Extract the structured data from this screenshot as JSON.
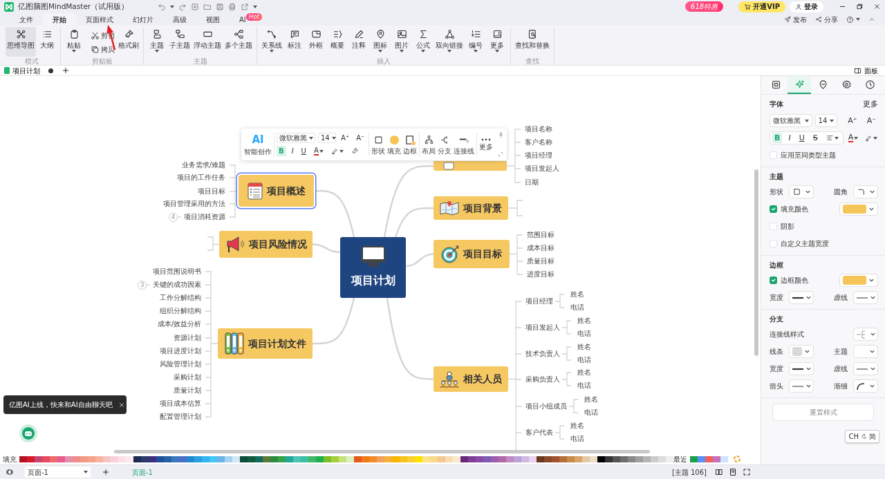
{
  "app": {
    "title": "亿图脑图MindMaster（试用版）"
  },
  "promo": {
    "label": "618特惠"
  },
  "vip_button": {
    "label": "开通VIP"
  },
  "login_button": {
    "label": "登录"
  },
  "menu_tabs": [
    {
      "label": "文件",
      "selected": false
    },
    {
      "label": "开始",
      "selected": true
    },
    {
      "label": "页面样式",
      "selected": false
    },
    {
      "label": "幻灯片",
      "selected": false
    },
    {
      "label": "高级",
      "selected": false
    },
    {
      "label": "视图",
      "selected": false
    },
    {
      "label": "AI",
      "selected": false,
      "badge": "Hot"
    }
  ],
  "header_actions": [
    {
      "label": "发布"
    },
    {
      "label": "分享"
    }
  ],
  "ribbon_groups": [
    {
      "label": "模式",
      "items": [
        {
          "label": "思维导图",
          "kind": "large",
          "dropdown": false,
          "selected": true
        },
        {
          "label": "大纲",
          "kind": "large",
          "dropdown": false,
          "selected": false
        }
      ]
    },
    {
      "label": "剪贴板",
      "items": [
        {
          "label": "粘贴",
          "kind": "large",
          "dropdown": true
        },
        {
          "label": "剪切",
          "kind": "small",
          "dropdown": false
        },
        {
          "label": "拷贝",
          "kind": "small",
          "dropdown": false
        },
        {
          "label": "格式刷",
          "kind": "large",
          "dropdown": false
        }
      ]
    },
    {
      "label": "主题",
      "items": [
        {
          "label": "主题",
          "kind": "large",
          "dropdown": true
        },
        {
          "label": "子主题",
          "kind": "large",
          "dropdown": false
        },
        {
          "label": "浮动主题",
          "kind": "large",
          "dropdown": false
        },
        {
          "label": "多个主题",
          "kind": "large",
          "dropdown": false
        }
      ]
    },
    {
      "label": "插入",
      "items": [
        {
          "label": "关系线",
          "kind": "large",
          "dropdown": true
        },
        {
          "label": "标注",
          "kind": "large",
          "dropdown": false
        },
        {
          "label": "外框",
          "kind": "large",
          "dropdown": false
        },
        {
          "label": "概要",
          "kind": "large",
          "dropdown": false
        },
        {
          "label": "注释",
          "kind": "large",
          "dropdown": false
        },
        {
          "label": "图标",
          "kind": "large",
          "dropdown": true
        },
        {
          "label": "图片",
          "kind": "large",
          "dropdown": true
        },
        {
          "label": "公式",
          "kind": "large",
          "dropdown": true
        },
        {
          "label": "双向链接",
          "kind": "large",
          "dropdown": true
        },
        {
          "label": "编号",
          "kind": "large",
          "dropdown": true
        },
        {
          "label": "更多",
          "kind": "large",
          "dropdown": true
        }
      ]
    },
    {
      "label": "查找",
      "items": [
        {
          "label": "查找和替换",
          "kind": "large",
          "dropdown": false
        }
      ]
    }
  ],
  "doc_tabs": [
    {
      "label": "项目计划",
      "selected": true,
      "unsaved": true
    }
  ],
  "panel_toggle": {
    "label": "面板"
  },
  "format_toolbar": {
    "ai": "AI",
    "ai_label": "智能创作",
    "font": "微软雅黑",
    "size": "14",
    "grow": "A⁺",
    "shrink": "A⁻",
    "styles": [
      {
        "label": "B",
        "selected": true
      },
      {
        "label": "I",
        "selected": false
      },
      {
        "label": "U",
        "selected": false
      }
    ],
    "color_label": "A",
    "color": "#e02020",
    "tools": [
      "形状",
      "填充",
      "边框",
      "布局",
      "分支",
      "连接线",
      "更多"
    ]
  },
  "mindmap": {
    "central": "项目计划",
    "topics": [
      {
        "label": "项目概述",
        "selected": true,
        "children": [
          {
            "label": "业务需求/难题"
          },
          {
            "label": "项目的工作任务"
          },
          {
            "label": "项目目标"
          },
          {
            "label": "项目管理采用的方法"
          },
          {
            "label": "项目消耗资源",
            "collapsed_count": "4"
          }
        ]
      },
      {
        "label": "项目风险情况",
        "selected": false
      },
      {
        "label": "项目计划文件",
        "selected": false,
        "children": [
          {
            "label": "项目范围说明书"
          },
          {
            "label": "关键的成功因素",
            "collapsed_count": "3"
          },
          {
            "label": "工作分解结构"
          },
          {
            "label": "组织分解结构"
          },
          {
            "label": "成本/效益分析"
          },
          {
            "label": "资源计划"
          },
          {
            "label": "项目进度计划"
          },
          {
            "label": "风险管理计划"
          },
          {
            "label": "采购计划"
          },
          {
            "label": "质量计划"
          },
          {
            "label": "项目成本估算"
          },
          {
            "label": "配置管理计划"
          }
        ]
      },
      {
        "selected": false,
        "children": [
          {
            "label": "项目名称"
          },
          {
            "label": "客户名称"
          },
          {
            "label": "项目经理"
          },
          {
            "label": "项目发起人"
          },
          {
            "label": "日期"
          }
        ]
      },
      {
        "label": "项目背景",
        "selected": false
      },
      {
        "label": "项目目标",
        "selected": false,
        "children": [
          {
            "label": "范围目标"
          },
          {
            "label": "成本目标"
          },
          {
            "label": "质量目标"
          },
          {
            "label": "进度目标"
          }
        ]
      },
      {
        "label": "相关人员",
        "selected": false,
        "children": [
          {
            "label": "项目经理",
            "children": [
              {
                "label": "姓名"
              },
              {
                "label": "电话"
              }
            ]
          },
          {
            "label": "项目发起人",
            "children": [
              {
                "label": "姓名"
              },
              {
                "label": "电话"
              }
            ]
          },
          {
            "label": "技术负责人",
            "children": [
              {
                "label": "姓名"
              },
              {
                "label": "电话"
              }
            ]
          },
          {
            "label": "采购负责人",
            "children": [
              {
                "label": "姓名"
              },
              {
                "label": "电话"
              }
            ]
          },
          {
            "label": "项目小组成员",
            "children": [
              {
                "label": "姓名"
              },
              {
                "label": "电话"
              }
            ]
          },
          {
            "label": "客户代表",
            "children": [
              {
                "label": "姓名"
              },
              {
                "label": "电话"
              }
            ]
          }
        ]
      }
    ]
  },
  "ai_tip": {
    "text": "亿图AI上线，快来和AI自由聊天吧"
  },
  "panel": {
    "tabs": [
      {
        "selected": false
      },
      {
        "selected": true
      },
      {
        "selected": false
      },
      {
        "selected": false
      },
      {
        "selected": false
      }
    ],
    "sections": [
      {
        "title": "字体",
        "more": "更多",
        "rows": [
          {
            "kind": "font",
            "font": "微软雅黑",
            "size": "14",
            "grow": "A⁺",
            "shrink": "A⁻"
          },
          {
            "kind": "format",
            "styles": [
              {
                "label": "B",
                "selected": true
              },
              {
                "label": "I",
                "selected": false
              },
              {
                "label": "U",
                "selected": false
              },
              {
                "label": "S",
                "selected": false
              }
            ],
            "color_label": "A",
            "color": "#e02020"
          },
          {
            "kind": "check",
            "label": "应用至同类型主题",
            "checked": false
          }
        ]
      },
      {
        "title": "主题",
        "rows": [
          {
            "kind": "pair",
            "items": [
              {
                "label": "形状",
                "kind": "shape"
              },
              {
                "label": "圆角",
                "kind": "corner"
              }
            ]
          },
          {
            "kind": "check",
            "label": "填充颜色",
            "checked": true,
            "color": "#f5c55a"
          },
          {
            "kind": "check",
            "label": "阴影",
            "checked": false
          },
          {
            "kind": "check",
            "label": "自定义主题宽度",
            "checked": false
          }
        ]
      },
      {
        "title": "边框",
        "rows": [
          {
            "kind": "check",
            "label": "边框颜色",
            "checked": true,
            "color": "#f5c55a"
          },
          {
            "kind": "pair",
            "items": [
              {
                "label": "宽度",
                "kind": "thick"
              },
              {
                "label": "虚线",
                "kind": "thin"
              }
            ]
          }
        ]
      },
      {
        "title": "分支",
        "rows": [
          {
            "kind": "single",
            "items": [
              {
                "label": "连接线样式",
                "kind": "connector"
              }
            ]
          },
          {
            "kind": "pair",
            "items": [
              {
                "label": "线条",
                "kind": "swatch",
                "color": "#d9d9d9"
              },
              {
                "label": "主题",
                "kind": "empty"
              }
            ]
          },
          {
            "kind": "pair",
            "items": [
              {
                "label": "宽度",
                "kind": "thick"
              },
              {
                "label": "虚线",
                "kind": "thin"
              }
            ]
          },
          {
            "kind": "pair",
            "items": [
              {
                "label": "箭头",
                "kind": "thin"
              },
              {
                "label": "渐细",
                "kind": "taper"
              }
            ]
          }
        ]
      }
    ],
    "reset": {
      "label": "重置样式",
      "disabled": true
    }
  },
  "ime": {
    "lang": "CH",
    "mode": "简"
  },
  "palette": {
    "label": "填充",
    "recent_label": "最近",
    "swatches": [
      {
        "color": "#b3121f"
      },
      {
        "color": "#d71a2a"
      },
      {
        "color": "#c5476f"
      },
      {
        "color": "#e84a5f"
      },
      {
        "color": "#ef6b6b"
      },
      {
        "color": "#e65c8e"
      },
      {
        "color": "#e58fb0"
      },
      {
        "color": "#f08b8b"
      },
      {
        "color": "#f29b84"
      },
      {
        "color": "#f6a38a"
      },
      {
        "color": "#f9b4a0"
      },
      {
        "color": "#f7c4c4"
      },
      {
        "color": "#f8d0dc"
      },
      {
        "color": "#fce0e8"
      },
      {
        "color": "#fde9ee"
      },
      {
        "color": "#1b2a4e"
      },
      {
        "color": "#2a3a6e"
      },
      {
        "color": "#3c2f80"
      },
      {
        "color": "#1f4f9a"
      },
      {
        "color": "#2462a8"
      },
      {
        "color": "#3a7bbf"
      },
      {
        "color": "#4a6fc5"
      },
      {
        "color": "#1f8ad2"
      },
      {
        "color": "#2aa0e0"
      },
      {
        "color": "#33b5f0"
      },
      {
        "color": "#45c6f5"
      },
      {
        "color": "#6fb3e6"
      },
      {
        "color": "#a7d2f0"
      },
      {
        "color": "#d0e8f7"
      },
      {
        "color": "#0d4d3a"
      },
      {
        "color": "#0f5c3b"
      },
      {
        "color": "#116b5a"
      },
      {
        "color": "#5a7a3a"
      },
      {
        "color": "#2e8b3e"
      },
      {
        "color": "#35a34a"
      },
      {
        "color": "#20a89a"
      },
      {
        "color": "#4fc1b5"
      },
      {
        "color": "#3bbfa0"
      },
      {
        "color": "#44b86a"
      },
      {
        "color": "#1fb14d"
      },
      {
        "color": "#7cbf2a"
      },
      {
        "color": "#a6cf3c"
      },
      {
        "color": "#c6e27a"
      },
      {
        "color": "#dcefc0"
      },
      {
        "color": "#e55a1c"
      },
      {
        "color": "#ef7a1a"
      },
      {
        "color": "#f28c28"
      },
      {
        "color": "#f5a05a"
      },
      {
        "color": "#f7b03a"
      },
      {
        "color": "#f8b500"
      },
      {
        "color": "#f9c31f"
      },
      {
        "color": "#fbd12d"
      },
      {
        "color": "#fde100"
      },
      {
        "color": "#fbe38a"
      },
      {
        "color": "#f8d98a"
      },
      {
        "color": "#f2c893"
      },
      {
        "color": "#f7dcb0"
      },
      {
        "color": "#fbe9cf"
      },
      {
        "color": "#6a2a7a"
      },
      {
        "color": "#7f3f98"
      },
      {
        "color": "#8a4aa8"
      },
      {
        "color": "#7d5cb4"
      },
      {
        "color": "#9a5fb0"
      },
      {
        "color": "#b06aa8"
      },
      {
        "color": "#c28ac0"
      },
      {
        "color": "#b8a2d6"
      },
      {
        "color": "#d3b8e0"
      },
      {
        "color": "#e6d2ee"
      },
      {
        "color": "#6b3a1e"
      },
      {
        "color": "#8a4a2a"
      },
      {
        "color": "#a0522d"
      },
      {
        "color": "#b5703a"
      },
      {
        "color": "#c98a4a"
      },
      {
        "color": "#d9a46a"
      },
      {
        "color": "#e3c9a5"
      },
      {
        "color": "#ecdcc6"
      },
      {
        "color": "#000000"
      },
      {
        "color": "#333333"
      },
      {
        "color": "#555555"
      },
      {
        "color": "#6e6e6e"
      },
      {
        "color": "#888888"
      },
      {
        "color": "#a0a0a0"
      },
      {
        "color": "#b5b5b5"
      },
      {
        "color": "#cccccc"
      },
      {
        "color": "#dddddd"
      },
      {
        "color": "#eeeeee"
      }
    ],
    "recent": [
      {
        "color": "#1a9f4a"
      },
      {
        "color": "#5b8ff9"
      },
      {
        "color": "#f0605a"
      },
      {
        "color": "#c770b8"
      },
      {
        "color": "#d0e4ff"
      }
    ]
  },
  "status_bar": {
    "page_select": "页面-1",
    "page_tabs": [
      {
        "label": "页面-1",
        "selected": true
      }
    ],
    "topic_count": "[主题 106]"
  }
}
